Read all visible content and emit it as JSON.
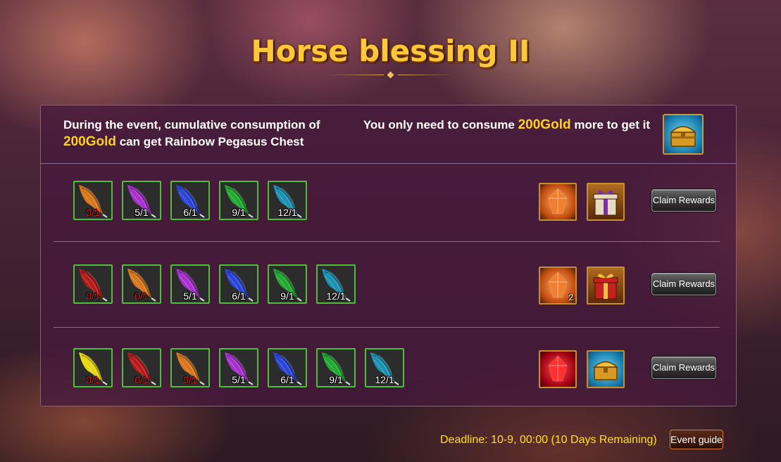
{
  "title": "Horse blessing II",
  "info": {
    "left_prefix": "During the event, cumulative consumption of",
    "left_gold": "200Gold",
    "left_suffix": "can get Rainbow Pegasus Chest",
    "right_prefix": "You only need to consume",
    "right_gold": "200Gold",
    "right_suffix": "more to get it",
    "chest_icon": "rainbow-pegasus-chest-icon"
  },
  "colors": {
    "orange": "#e07a1a",
    "purple": "#b030d8",
    "blue": "#2a48e0",
    "green": "#22b030",
    "teal": "#1a98b8",
    "red": "#c01818",
    "yellow": "#f0e010",
    "accent_gold": "#ffd21a"
  },
  "rows": [
    {
      "feathers": [
        {
          "color": "orange",
          "count": "0/1",
          "insufficient": true
        },
        {
          "color": "purple",
          "count": "5/1",
          "insufficient": false
        },
        {
          "color": "blue",
          "count": "6/1",
          "insufficient": false
        },
        {
          "color": "green",
          "count": "9/1",
          "insufficient": false
        },
        {
          "color": "teal",
          "count": "12/1",
          "insufficient": false
        }
      ],
      "rewards": [
        {
          "icon": "orange-crystal-icon",
          "qty": ""
        },
        {
          "icon": "purple-gift-box-icon",
          "qty": ""
        }
      ],
      "claim_label": "Claim Rewards"
    },
    {
      "feathers": [
        {
          "color": "red",
          "count": "0/1",
          "insufficient": true
        },
        {
          "color": "orange",
          "count": "0/1",
          "insufficient": true
        },
        {
          "color": "purple",
          "count": "5/1",
          "insufficient": false
        },
        {
          "color": "blue",
          "count": "6/1",
          "insufficient": false
        },
        {
          "color": "green",
          "count": "9/1",
          "insufficient": false
        },
        {
          "color": "teal",
          "count": "12/1",
          "insufficient": false
        }
      ],
      "rewards": [
        {
          "icon": "orange-crystal-icon",
          "qty": "2"
        },
        {
          "icon": "red-gift-box-icon",
          "qty": ""
        }
      ],
      "claim_label": "Claim Rewards"
    },
    {
      "feathers": [
        {
          "color": "yellow",
          "count": "0/1",
          "insufficient": true
        },
        {
          "color": "red",
          "count": "0/1",
          "insufficient": true
        },
        {
          "color": "orange",
          "count": "0/1",
          "insufficient": true
        },
        {
          "color": "purple",
          "count": "5/1",
          "insufficient": false
        },
        {
          "color": "blue",
          "count": "6/1",
          "insufficient": false
        },
        {
          "color": "green",
          "count": "9/1",
          "insufficient": false
        },
        {
          "color": "teal",
          "count": "12/1",
          "insufficient": false
        }
      ],
      "rewards": [
        {
          "icon": "red-crystal-icon",
          "qty": ""
        },
        {
          "icon": "golden-chest-icon",
          "qty": ""
        }
      ],
      "claim_label": "Claim Rewards"
    }
  ],
  "footer": {
    "deadline": "Deadline: 10-9, 00:00 (10 Days Remaining)",
    "guide_label": "Event guide"
  }
}
